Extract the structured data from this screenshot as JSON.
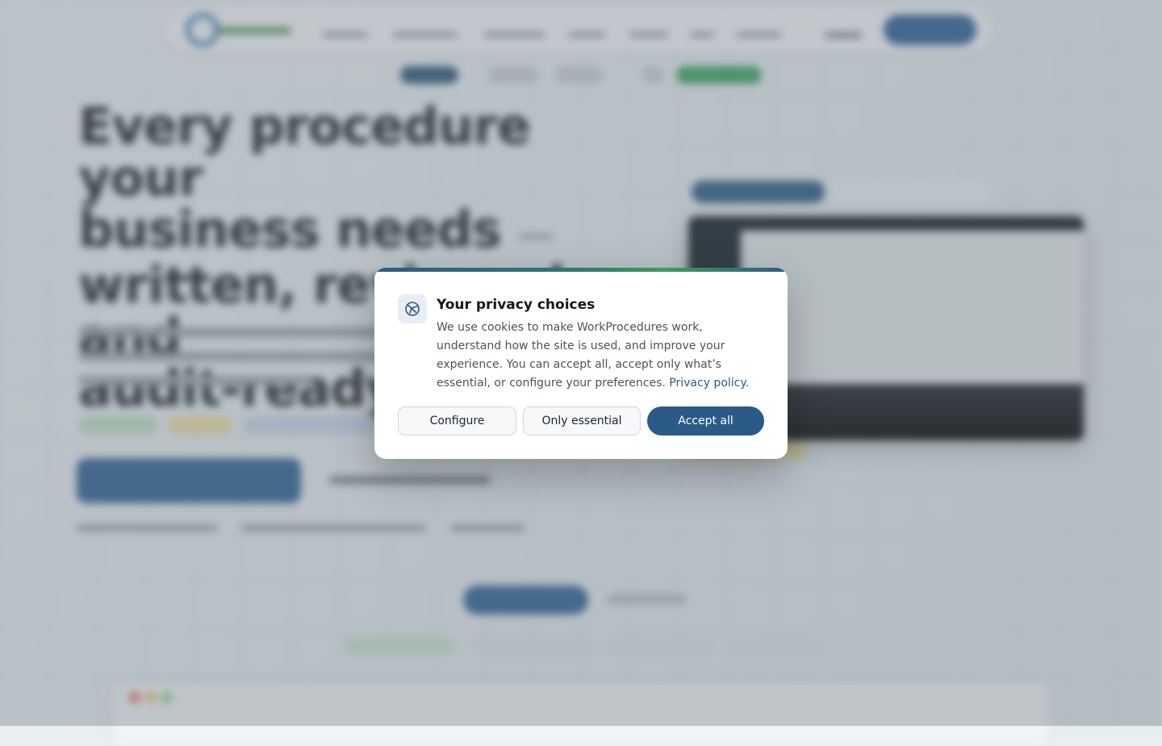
{
  "background_page": {
    "headline_lines": [
      "Every procedure your",
      "business needs",
      "written, reviewed, and",
      "audit-ready."
    ],
    "headline_dash": "—"
  },
  "consent_dialog": {
    "title": "Your privacy choices",
    "body": "We use cookies to make WorkProcedures work, understand how the site is used, and improve your experience. You can accept all, accept only what’s essential, or configure your preferences.",
    "privacy_link": "Privacy policy",
    "after_link": ".",
    "buttons": {
      "configure": "Configure",
      "essential": "Only essential",
      "accept": "Accept all"
    },
    "icon": "cookie-shield-icon"
  },
  "colors": {
    "primary": "#2b5a86",
    "accent_green": "#3e9c5a"
  }
}
